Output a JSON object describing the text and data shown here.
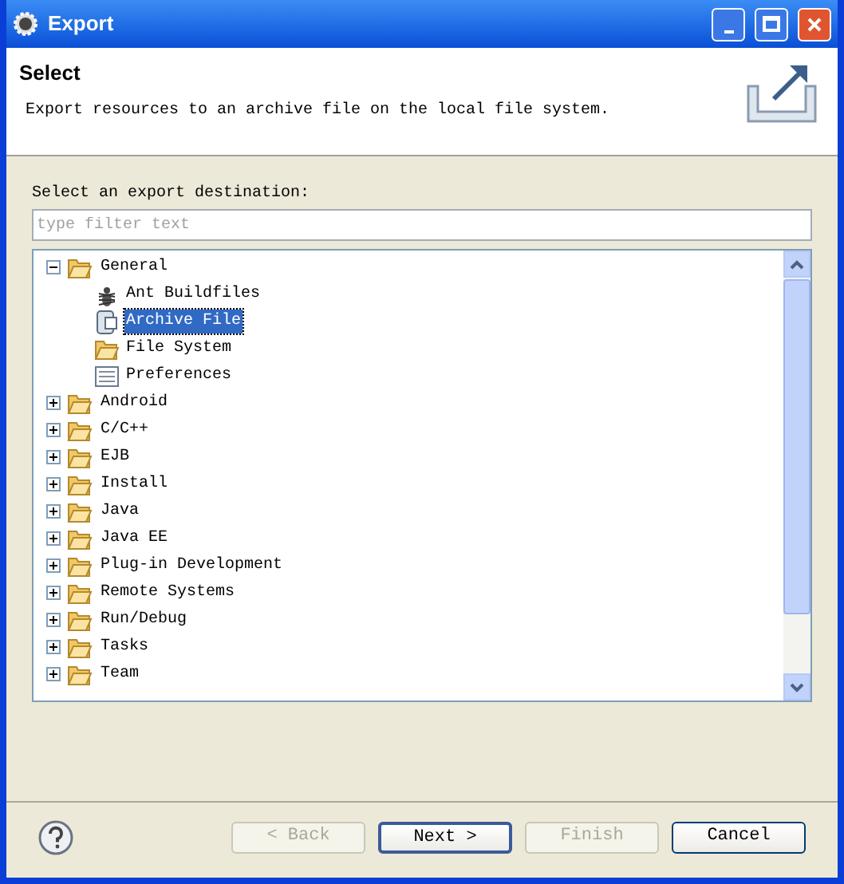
{
  "window": {
    "title": "Export"
  },
  "header": {
    "title": "Select",
    "description": "Export resources to an archive file on the local file system."
  },
  "destination_label": "Select an export destination:",
  "filter": {
    "placeholder": "type filter text"
  },
  "tree": [
    {
      "label": "General",
      "expanded": true,
      "selected": false,
      "children": [
        {
          "label": "Ant Buildfiles",
          "kind": "ant",
          "selected": false
        },
        {
          "label": "Archive File",
          "kind": "archive",
          "selected": true
        },
        {
          "label": "File System",
          "kind": "folder",
          "selected": false
        },
        {
          "label": "Preferences",
          "kind": "preferences",
          "selected": false
        }
      ]
    },
    {
      "label": "Android",
      "expanded": false,
      "selected": false
    },
    {
      "label": "C/C++",
      "expanded": false,
      "selected": false
    },
    {
      "label": "EJB",
      "expanded": false,
      "selected": false
    },
    {
      "label": "Install",
      "expanded": false,
      "selected": false
    },
    {
      "label": "Java",
      "expanded": false,
      "selected": false
    },
    {
      "label": "Java EE",
      "expanded": false,
      "selected": false
    },
    {
      "label": "Plug-in Development",
      "expanded": false,
      "selected": false
    },
    {
      "label": "Remote Systems",
      "expanded": false,
      "selected": false
    },
    {
      "label": "Run/Debug",
      "expanded": false,
      "selected": false
    },
    {
      "label": "Tasks",
      "expanded": false,
      "selected": false
    },
    {
      "label": "Team",
      "expanded": false,
      "selected": false
    }
  ],
  "buttons": [
    {
      "label": "< Back",
      "disabled": true,
      "default": false
    },
    {
      "label": "Next >",
      "disabled": false,
      "default": true
    },
    {
      "label": "Finish",
      "disabled": true,
      "default": false
    },
    {
      "label": "Cancel",
      "disabled": false,
      "default": false
    }
  ]
}
